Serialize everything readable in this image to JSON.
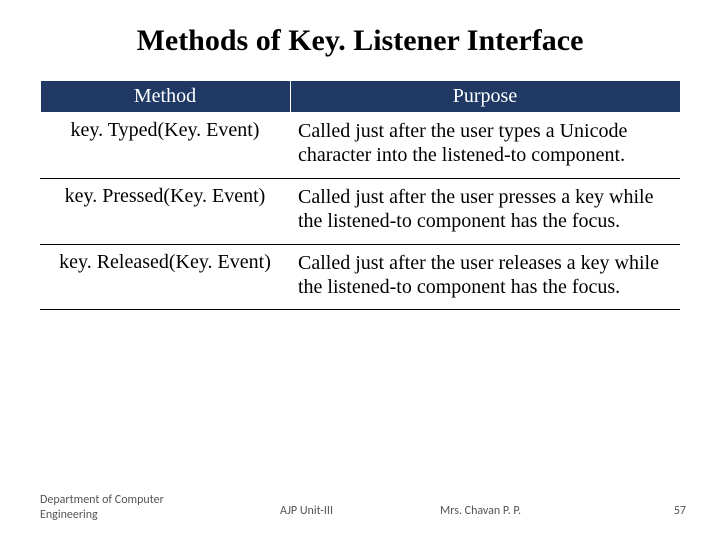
{
  "title": "Methods of Key. Listener Interface",
  "headers": {
    "method": "Method",
    "purpose": "Purpose"
  },
  "rows": [
    {
      "method": "key. Typed(Key. Event)",
      "purpose": "Called just after the user types a Unicode character into the listened-to component."
    },
    {
      "method": "key. Pressed(Key. Event)",
      "purpose": "Called just after the user presses a key while the listened-to component has the focus."
    },
    {
      "method": "key. Released(Key. Event)",
      "purpose": "Called just after the user releases a key while the listened-to component has the focus."
    }
  ],
  "footer": {
    "dept_line1": "Department of Computer",
    "dept_line2": "Engineering",
    "unit": "AJP Unit-III",
    "author": "Mrs. Chavan P. P.",
    "page": "57"
  }
}
